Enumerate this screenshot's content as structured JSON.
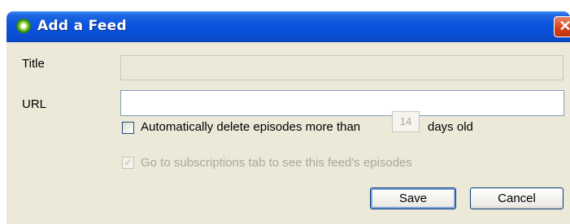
{
  "dialog": {
    "title": "Add a Feed",
    "close_glyph": "✕",
    "title_label": "Title",
    "title_value": "",
    "url_label": "URL",
    "url_value": "",
    "auto_delete": {
      "checked": false,
      "label_before": "Automatically delete episodes more than",
      "days_value": "14",
      "label_after": "days old"
    },
    "goto_subscriptions": {
      "checked": true,
      "enabled": false,
      "check_glyph": "✓",
      "label": "Go to subscriptions tab to see this feed's episodes"
    },
    "save_label": "Save",
    "cancel_label": "Cancel"
  },
  "colors": {
    "titlebar": "#0a54de",
    "dialog_bg": "#ece9d8",
    "close_button": "#d6431c"
  }
}
